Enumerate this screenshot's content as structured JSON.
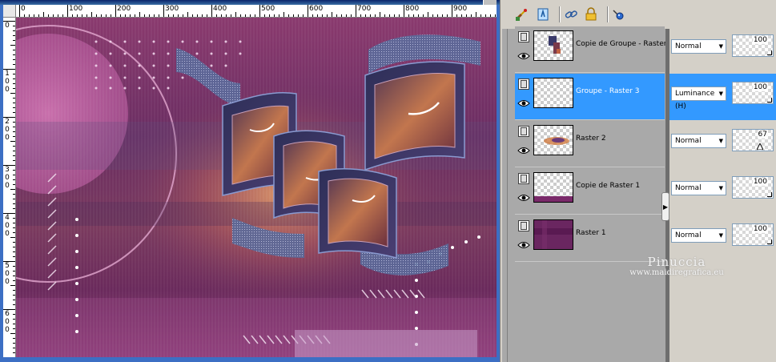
{
  "ruler": {
    "top_labels": [
      "0",
      "100",
      "200",
      "300",
      "400",
      "500",
      "600",
      "700",
      "800",
      "900"
    ],
    "left_labels": [
      [
        "0"
      ],
      [
        "1",
        "0",
        "0"
      ],
      [
        "2",
        "0",
        "0"
      ],
      [
        "3",
        "0",
        "0"
      ],
      [
        "4",
        "0",
        "0"
      ],
      [
        "5",
        "0",
        "0"
      ],
      [
        "6",
        "0",
        "0"
      ]
    ]
  },
  "toolbar": {
    "buttons": [
      "paintbrush-icon",
      "new-layer-icon",
      "link-icon",
      "lock-icon",
      "pin-icon"
    ]
  },
  "layers": [
    {
      "name": "Copie de Groupe - Raster",
      "blend_mode": "Normal",
      "opacity": "100",
      "selected": false
    },
    {
      "name": "Groupe - Raster 3",
      "blend_mode": "Luminance (H)",
      "opacity": "100",
      "selected": true
    },
    {
      "name": "Raster 2",
      "blend_mode": "Normal",
      "opacity": "67",
      "selected": false
    },
    {
      "name": "Copie de Raster 1",
      "blend_mode": "Normal",
      "opacity": "100",
      "selected": false
    },
    {
      "name": "Raster 1",
      "blend_mode": "Normal",
      "opacity": "100",
      "selected": false
    }
  ],
  "splitter_arrow": "▶",
  "watermark": {
    "line1": "Pinuccia",
    "line2": "www.maidiregrafica.eu"
  },
  "colors": {
    "selection": "#3399ff",
    "panel": "#d4d0c8",
    "list_bg": "#a9a9a9"
  }
}
